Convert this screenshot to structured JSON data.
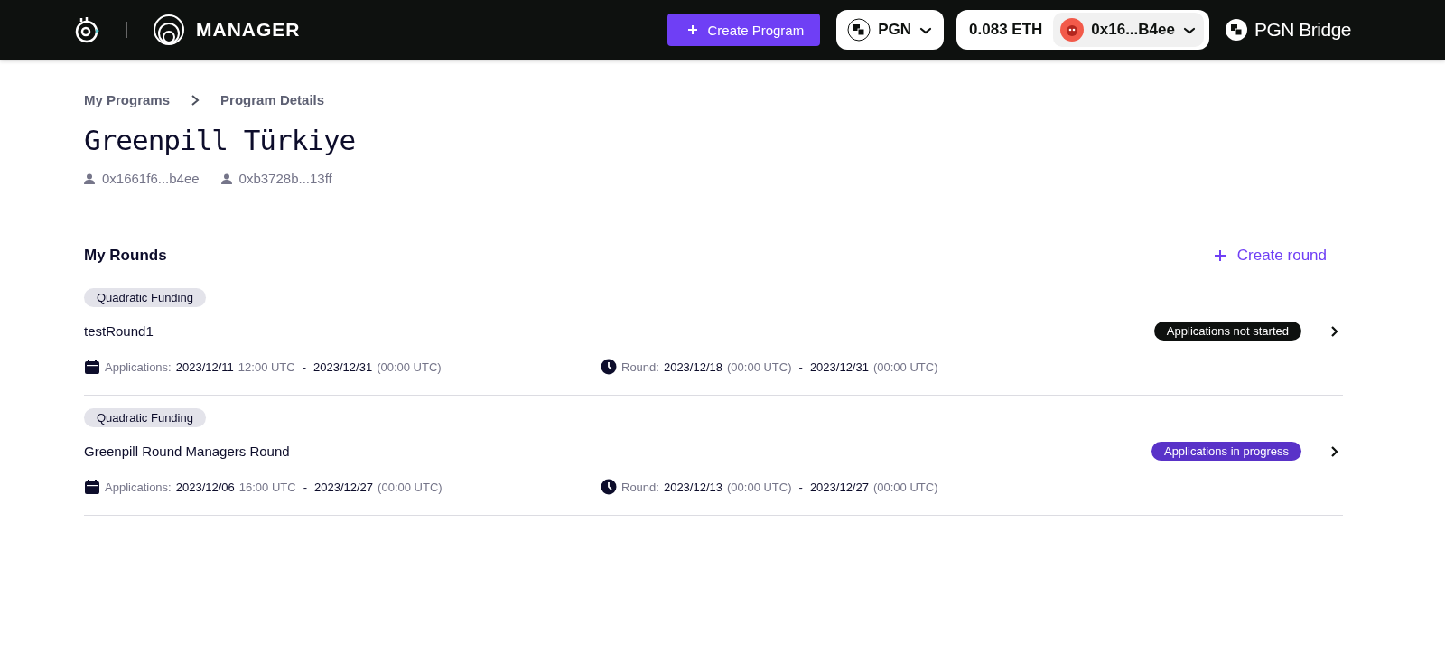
{
  "header": {
    "brand": "MANAGER",
    "create_program": "Create Program",
    "network": "PGN",
    "balance": "0.083 ETH",
    "account": "0x16...B4ee",
    "bridge": "PGN Bridge"
  },
  "breadcrumb": [
    {
      "label": "My Programs"
    },
    {
      "label": "Program Details"
    }
  ],
  "program": {
    "title": "Greenpill Türkiye",
    "operators": [
      "0x1661f6...b4ee",
      "0xb3728b...13ff"
    ]
  },
  "rounds_section": {
    "title": "My Rounds",
    "create_round": "Create round"
  },
  "rounds": [
    {
      "type": "Quadratic Funding",
      "name": "testRound1",
      "status": "Applications not started",
      "color": "#0e110f",
      "applications_label": "Applications:",
      "app_start_date": "2023/12/11",
      "app_start_time": "12:00 UTC",
      "app_separator": "-",
      "app_end_date": "2023/12/31",
      "app_end_time": "(00:00 UTC)",
      "round_label": "Round:",
      "round_start_date": "2023/12/18",
      "round_start_time": "(00:00 UTC)",
      "round_separator": "-",
      "round_end_date": "2023/12/31",
      "round_end_time": "(00:00 UTC)"
    },
    {
      "type": "Quadratic Funding",
      "name": "Greenpill Round Managers Round",
      "status": "Applications in progress",
      "color": "#5932c8",
      "applications_label": "Applications:",
      "app_start_date": "2023/12/06",
      "app_start_time": "16:00 UTC",
      "app_separator": "-",
      "app_end_date": "2023/12/27",
      "app_end_time": "(00:00 UTC)",
      "round_label": "Round:",
      "round_start_date": "2023/12/13",
      "round_start_time": "(00:00 UTC)",
      "round_separator": "-",
      "round_end_date": "2023/12/27",
      "round_end_time": "(00:00 UTC)"
    }
  ]
}
